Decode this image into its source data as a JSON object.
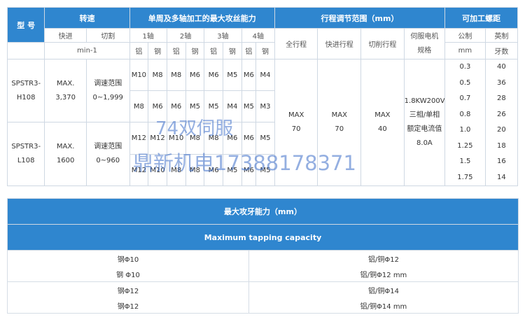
{
  "header": {
    "model": "型  号",
    "speed": "转速",
    "capacity": "单周及多轴加工的最大攻丝能力",
    "adjust": "行程调节范围（mm）",
    "pitch": "可加工螺距",
    "fast": "快进",
    "cut": "切割",
    "unit_speed": "min-1",
    "axes": [
      "1轴",
      "2轴",
      "3轴",
      "4轴"
    ],
    "al": "铝",
    "steel": "钢",
    "full_stroke": "全行程",
    "fast_stroke": "快进行程",
    "cut_stroke": "切削行程",
    "servo_title1": "伺服电机",
    "servo_title2": "规格",
    "metric": "公制",
    "imperial": "英制",
    "unit_mm": "mm",
    "unit_teeth": "牙数"
  },
  "models": [
    {
      "name1": "SPSTR3-",
      "name2": "H108",
      "fast1": "MAX.",
      "fast2": "3,370",
      "cut1": "调速范围",
      "cut2": "0~1,999",
      "rows": [
        [
          "M10",
          "M8",
          "M8",
          "M6",
          "M6",
          "M5",
          "M6",
          "M4"
        ],
        [
          "M8",
          "M6",
          "M6",
          "M5",
          "M5",
          "M4",
          "M5",
          "M3"
        ]
      ]
    },
    {
      "name1": "SPSTR3-",
      "name2": "L108",
      "fast1": "MAX.",
      "fast2": "1600",
      "cut1": "调速范围",
      "cut2": "0~960",
      "rows": [
        [
          "M12",
          "M12",
          "M10",
          "M8",
          "M8",
          "M6",
          "M6",
          "M5"
        ],
        [
          "M12",
          "M10",
          "M8",
          "M8",
          "M6",
          "M5",
          "M6",
          "M5"
        ]
      ]
    }
  ],
  "stroke": {
    "full1": "MAX",
    "full2": "70",
    "fast1": "MAX",
    "fast2": "70",
    "cut1": "MAX",
    "cut2": "40"
  },
  "servo": [
    "1.8KW200V",
    "三相/单相",
    "额定电流值",
    "8.0A"
  ],
  "pitch": {
    "metric": [
      "0.3",
      "0.5",
      "0.7",
      "0.8",
      "1.0",
      "1.25",
      "1.5",
      "1.75"
    ],
    "imperial": [
      "40",
      "36",
      "28",
      "26",
      "20",
      "18",
      "16",
      "14"
    ]
  },
  "tapping": {
    "title": "最大攻牙能力（mm）",
    "subtitle": "Maximum tapping capacity",
    "rows": [
      [
        "钢Φ10",
        "铝/铜Φ12"
      ],
      [
        "钢 Φ10",
        "铝/铜Φ12 mm"
      ],
      [
        "钢Φ12",
        "铝/铜Φ14"
      ],
      [
        "钢Φ12",
        "铝/铜Φ14 mm"
      ]
    ]
  },
  "watermark": [
    "74双伺服",
    "鼎新机电17388178371"
  ]
}
